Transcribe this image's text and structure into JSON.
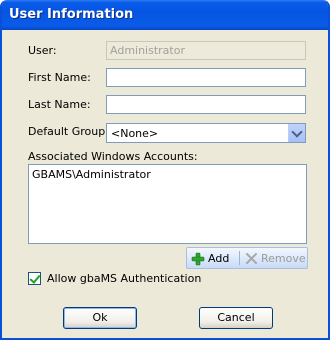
{
  "window": {
    "title": "User Information"
  },
  "form": {
    "user_label": "User:",
    "user_value": "Administrator",
    "first_name_label": "First Name:",
    "first_name_value": "",
    "last_name_label": "Last Name:",
    "last_name_value": "",
    "default_group_label": "Default Group:",
    "default_group_value": "<None>",
    "accounts_label": "Associated Windows Accounts:",
    "accounts": [
      "GBAMS\\Administrator"
    ],
    "add_label": "Add",
    "remove_label": "Remove",
    "allow_auth_label": "Allow gbaMS Authentication",
    "allow_auth_checked": true
  },
  "buttons": {
    "ok": "Ok",
    "cancel": "Cancel"
  }
}
